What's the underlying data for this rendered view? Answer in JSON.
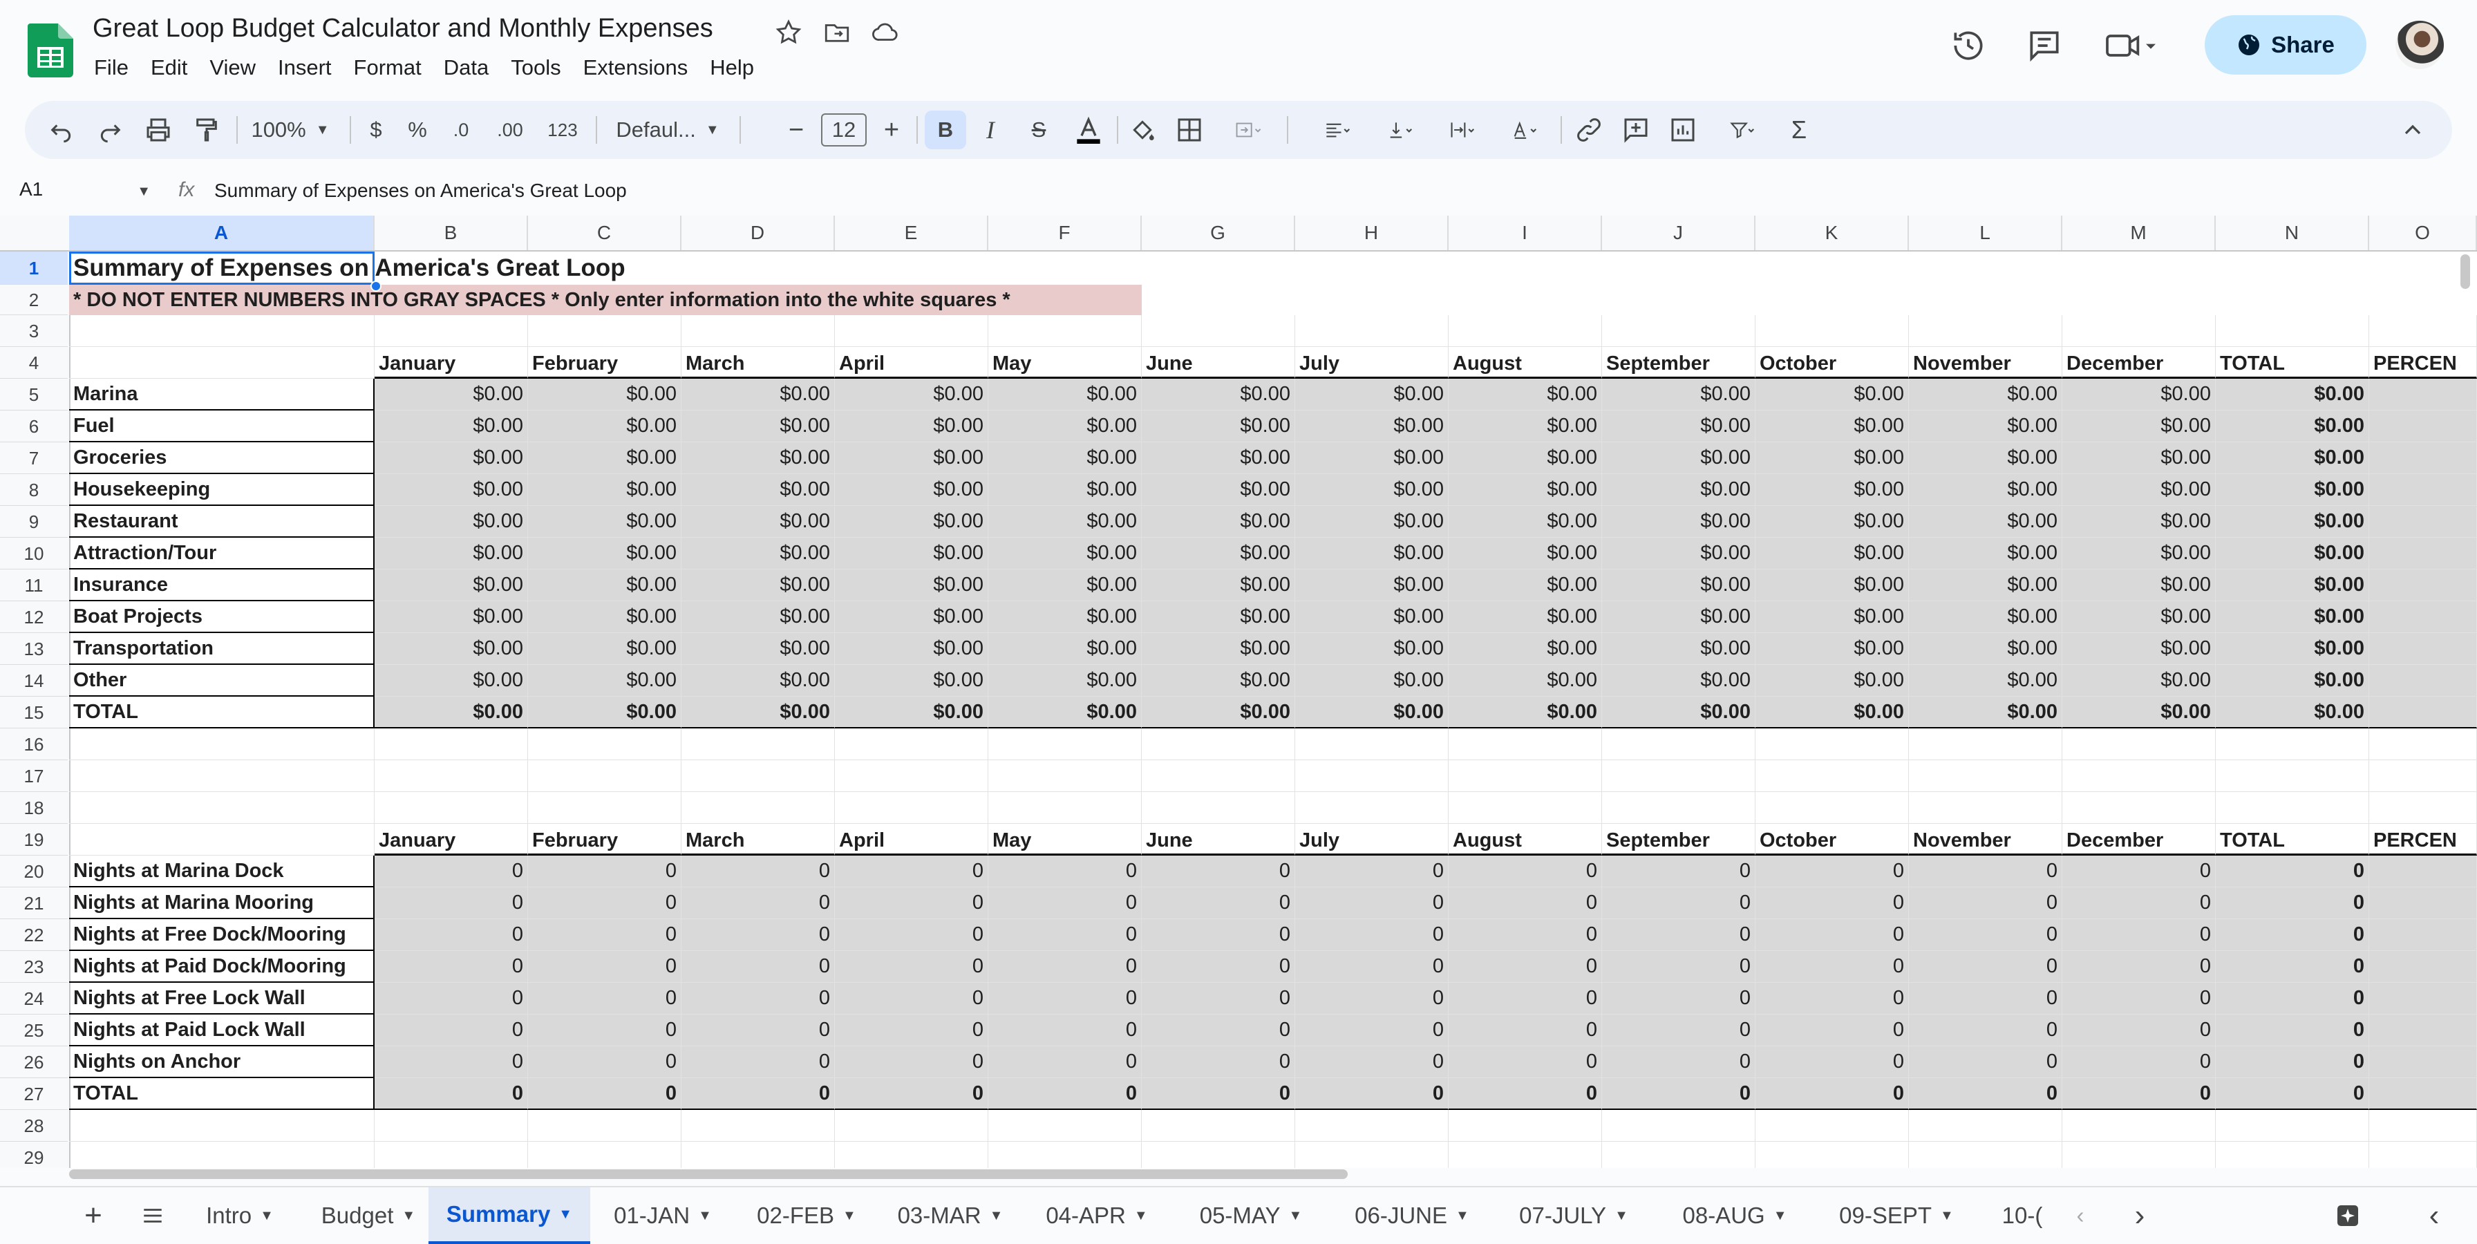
{
  "doc": {
    "title": "Great Loop Budget Calculator and Monthly Expenses"
  },
  "menu": [
    "File",
    "Edit",
    "View",
    "Insert",
    "Format",
    "Data",
    "Tools",
    "Extensions",
    "Help"
  ],
  "share": {
    "label": "Share"
  },
  "toolbar": {
    "zoom": "100%",
    "currency": "$",
    "percent": "%",
    "dec_dec": ".0",
    "dec_inc": ".00",
    "format_num": "123",
    "font": "Defaul...",
    "font_size": "12"
  },
  "formula_bar": {
    "cell_ref": "A1",
    "fx": "fx",
    "content": "Summary of Expenses on America's Great Loop"
  },
  "columns": [
    "A",
    "B",
    "C",
    "D",
    "E",
    "F",
    "G",
    "H",
    "I",
    "J",
    "K",
    "L",
    "M",
    "N",
    "O"
  ],
  "sheet": {
    "title": "Summary of Expenses on America's Great Loop",
    "warning": "* DO NOT ENTER NUMBERS INTO GRAY SPACES * Only enter information into the white squares *",
    "months": [
      "January",
      "February",
      "March",
      "April",
      "May",
      "June",
      "July",
      "August",
      "September",
      "October",
      "November",
      "December",
      "TOTAL",
      "PERCEN"
    ],
    "expense_rows": [
      {
        "label": "Marina",
        "values": [
          "$0.00",
          "$0.00",
          "$0.00",
          "$0.00",
          "$0.00",
          "$0.00",
          "$0.00",
          "$0.00",
          "$0.00",
          "$0.00",
          "$0.00",
          "$0.00",
          "$0.00"
        ]
      },
      {
        "label": "Fuel",
        "values": [
          "$0.00",
          "$0.00",
          "$0.00",
          "$0.00",
          "$0.00",
          "$0.00",
          "$0.00",
          "$0.00",
          "$0.00",
          "$0.00",
          "$0.00",
          "$0.00",
          "$0.00"
        ]
      },
      {
        "label": "Groceries",
        "values": [
          "$0.00",
          "$0.00",
          "$0.00",
          "$0.00",
          "$0.00",
          "$0.00",
          "$0.00",
          "$0.00",
          "$0.00",
          "$0.00",
          "$0.00",
          "$0.00",
          "$0.00"
        ]
      },
      {
        "label": "Housekeeping",
        "values": [
          "$0.00",
          "$0.00",
          "$0.00",
          "$0.00",
          "$0.00",
          "$0.00",
          "$0.00",
          "$0.00",
          "$0.00",
          "$0.00",
          "$0.00",
          "$0.00",
          "$0.00"
        ]
      },
      {
        "label": "Restaurant",
        "values": [
          "$0.00",
          "$0.00",
          "$0.00",
          "$0.00",
          "$0.00",
          "$0.00",
          "$0.00",
          "$0.00",
          "$0.00",
          "$0.00",
          "$0.00",
          "$0.00",
          "$0.00"
        ]
      },
      {
        "label": "Attraction/Tour",
        "values": [
          "$0.00",
          "$0.00",
          "$0.00",
          "$0.00",
          "$0.00",
          "$0.00",
          "$0.00",
          "$0.00",
          "$0.00",
          "$0.00",
          "$0.00",
          "$0.00",
          "$0.00"
        ]
      },
      {
        "label": "Insurance",
        "values": [
          "$0.00",
          "$0.00",
          "$0.00",
          "$0.00",
          "$0.00",
          "$0.00",
          "$0.00",
          "$0.00",
          "$0.00",
          "$0.00",
          "$0.00",
          "$0.00",
          "$0.00"
        ]
      },
      {
        "label": "Boat Projects",
        "values": [
          "$0.00",
          "$0.00",
          "$0.00",
          "$0.00",
          "$0.00",
          "$0.00",
          "$0.00",
          "$0.00",
          "$0.00",
          "$0.00",
          "$0.00",
          "$0.00",
          "$0.00"
        ]
      },
      {
        "label": "Transportation",
        "values": [
          "$0.00",
          "$0.00",
          "$0.00",
          "$0.00",
          "$0.00",
          "$0.00",
          "$0.00",
          "$0.00",
          "$0.00",
          "$0.00",
          "$0.00",
          "$0.00",
          "$0.00"
        ]
      },
      {
        "label": "Other",
        "values": [
          "$0.00",
          "$0.00",
          "$0.00",
          "$0.00",
          "$0.00",
          "$0.00",
          "$0.00",
          "$0.00",
          "$0.00",
          "$0.00",
          "$0.00",
          "$0.00",
          "$0.00"
        ]
      },
      {
        "label": "TOTAL",
        "values": [
          "$0.00",
          "$0.00",
          "$0.00",
          "$0.00",
          "$0.00",
          "$0.00",
          "$0.00",
          "$0.00",
          "$0.00",
          "$0.00",
          "$0.00",
          "$0.00",
          "$0.00"
        ]
      }
    ],
    "night_rows": [
      {
        "label": "Nights at Marina Dock",
        "values": [
          "0",
          "0",
          "0",
          "0",
          "0",
          "0",
          "0",
          "0",
          "0",
          "0",
          "0",
          "0",
          "0"
        ]
      },
      {
        "label": "Nights at Marina Mooring",
        "values": [
          "0",
          "0",
          "0",
          "0",
          "0",
          "0",
          "0",
          "0",
          "0",
          "0",
          "0",
          "0",
          "0"
        ]
      },
      {
        "label": "Nights at Free Dock/Mooring",
        "values": [
          "0",
          "0",
          "0",
          "0",
          "0",
          "0",
          "0",
          "0",
          "0",
          "0",
          "0",
          "0",
          "0"
        ]
      },
      {
        "label": "Nights at Paid Dock/Mooring",
        "values": [
          "0",
          "0",
          "0",
          "0",
          "0",
          "0",
          "0",
          "0",
          "0",
          "0",
          "0",
          "0",
          "0"
        ]
      },
      {
        "label": "Nights at Free Lock Wall",
        "values": [
          "0",
          "0",
          "0",
          "0",
          "0",
          "0",
          "0",
          "0",
          "0",
          "0",
          "0",
          "0",
          "0"
        ]
      },
      {
        "label": "Nights at Paid Lock Wall",
        "values": [
          "0",
          "0",
          "0",
          "0",
          "0",
          "0",
          "0",
          "0",
          "0",
          "0",
          "0",
          "0",
          "0"
        ]
      },
      {
        "label": "Nights on Anchor",
        "values": [
          "0",
          "0",
          "0",
          "0",
          "0",
          "0",
          "0",
          "0",
          "0",
          "0",
          "0",
          "0",
          "0"
        ]
      },
      {
        "label": "TOTAL",
        "values": [
          "0",
          "0",
          "0",
          "0",
          "0",
          "0",
          "0",
          "0",
          "0",
          "0",
          "0",
          "0",
          "0"
        ]
      }
    ],
    "row_numbers": [
      "1",
      "2",
      "3",
      "4",
      "5",
      "6",
      "7",
      "8",
      "9",
      "10",
      "11",
      "12",
      "13",
      "14",
      "15",
      "16",
      "17",
      "18",
      "19",
      "20",
      "21",
      "22",
      "23",
      "24",
      "25",
      "26",
      "27",
      "28",
      "29"
    ]
  },
  "tabs": [
    "Intro",
    "Budget",
    "Summary",
    "01-JAN",
    "02-FEB",
    "03-MAR",
    "04-APR",
    "05-MAY",
    "06-JUNE",
    "07-JULY",
    "08-AUG",
    "09-SEPT",
    "10-("
  ],
  "active_tab": "Summary",
  "colors": {
    "accent": "#0b57d0",
    "selection": "#d3e3fd",
    "gray_cell": "#d9d9d9",
    "warning_bg": "#eacbcb",
    "share_bg": "#c2e7ff",
    "sheets_green": "#0f9d58"
  }
}
